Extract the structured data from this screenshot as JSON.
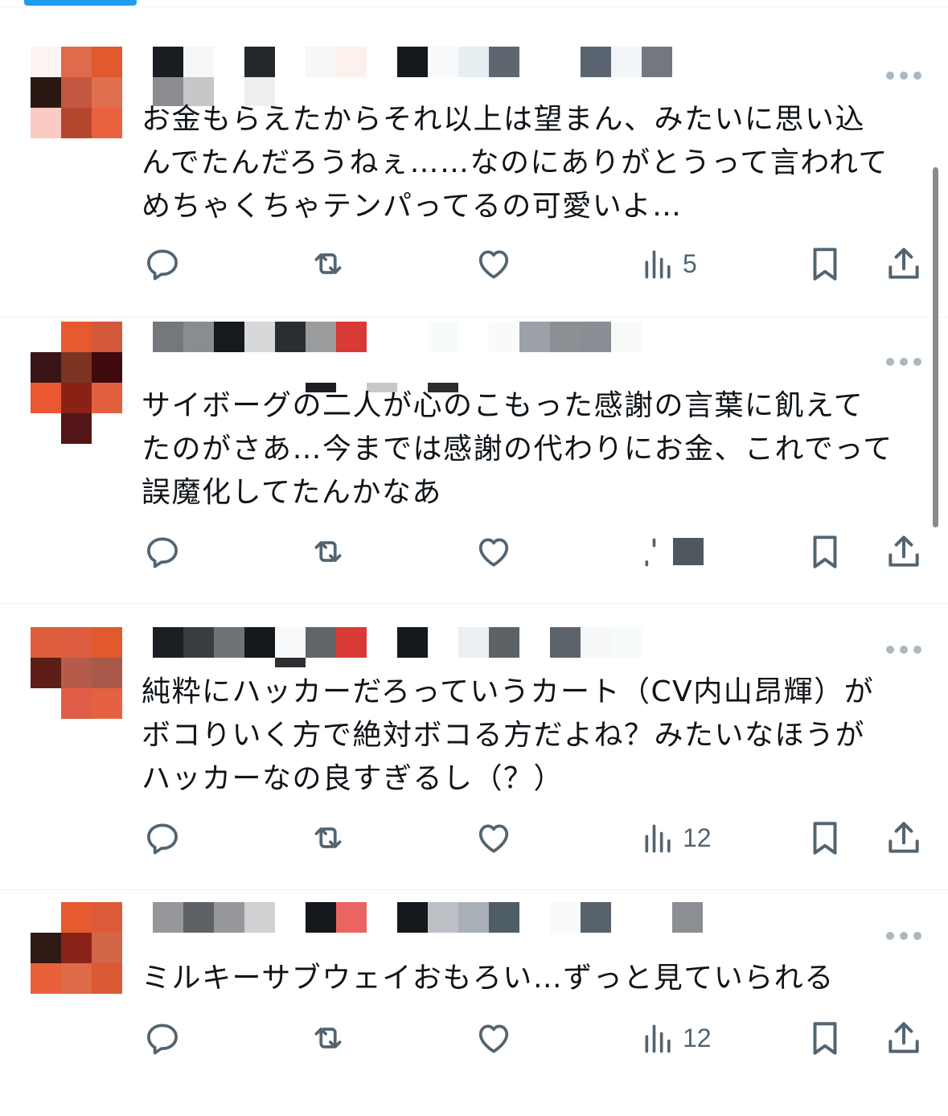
{
  "colors": {
    "accent": "#1d9bf0",
    "icon": "#536471",
    "text": "#0f1419",
    "divider": "#eff3f4"
  },
  "icons": [
    "reply-icon",
    "repost-icon",
    "like-icon",
    "views-icon",
    "bookmark-icon",
    "share-icon",
    "more-icon"
  ],
  "posts": [
    {
      "text": "お金もらえたからそれ以上は望まん、みたいに思い込\nんでたんだろうねぇ……なのにありがとうって言われて\nめちゃくちゃテンパってるの可愛いよ…",
      "views": "5"
    },
    {
      "text": "サイボーグの二人が心のこもった感謝の言葉に飢えて\nたのがさあ…今までは感謝の代わりにお金、これでって\n誤魔化してたんかなあ",
      "views": ""
    },
    {
      "text": "純粋にハッカーだろっていうカート（CV内山昂輝）が\nボコりいく方で絶対ボコる方だよね？みたいなほうが\nハッカーなの良すぎるし（？）",
      "views": "12"
    },
    {
      "text": "ミルキーサブウェイおもろい…ずっと見ていられる",
      "views": "12"
    }
  ]
}
